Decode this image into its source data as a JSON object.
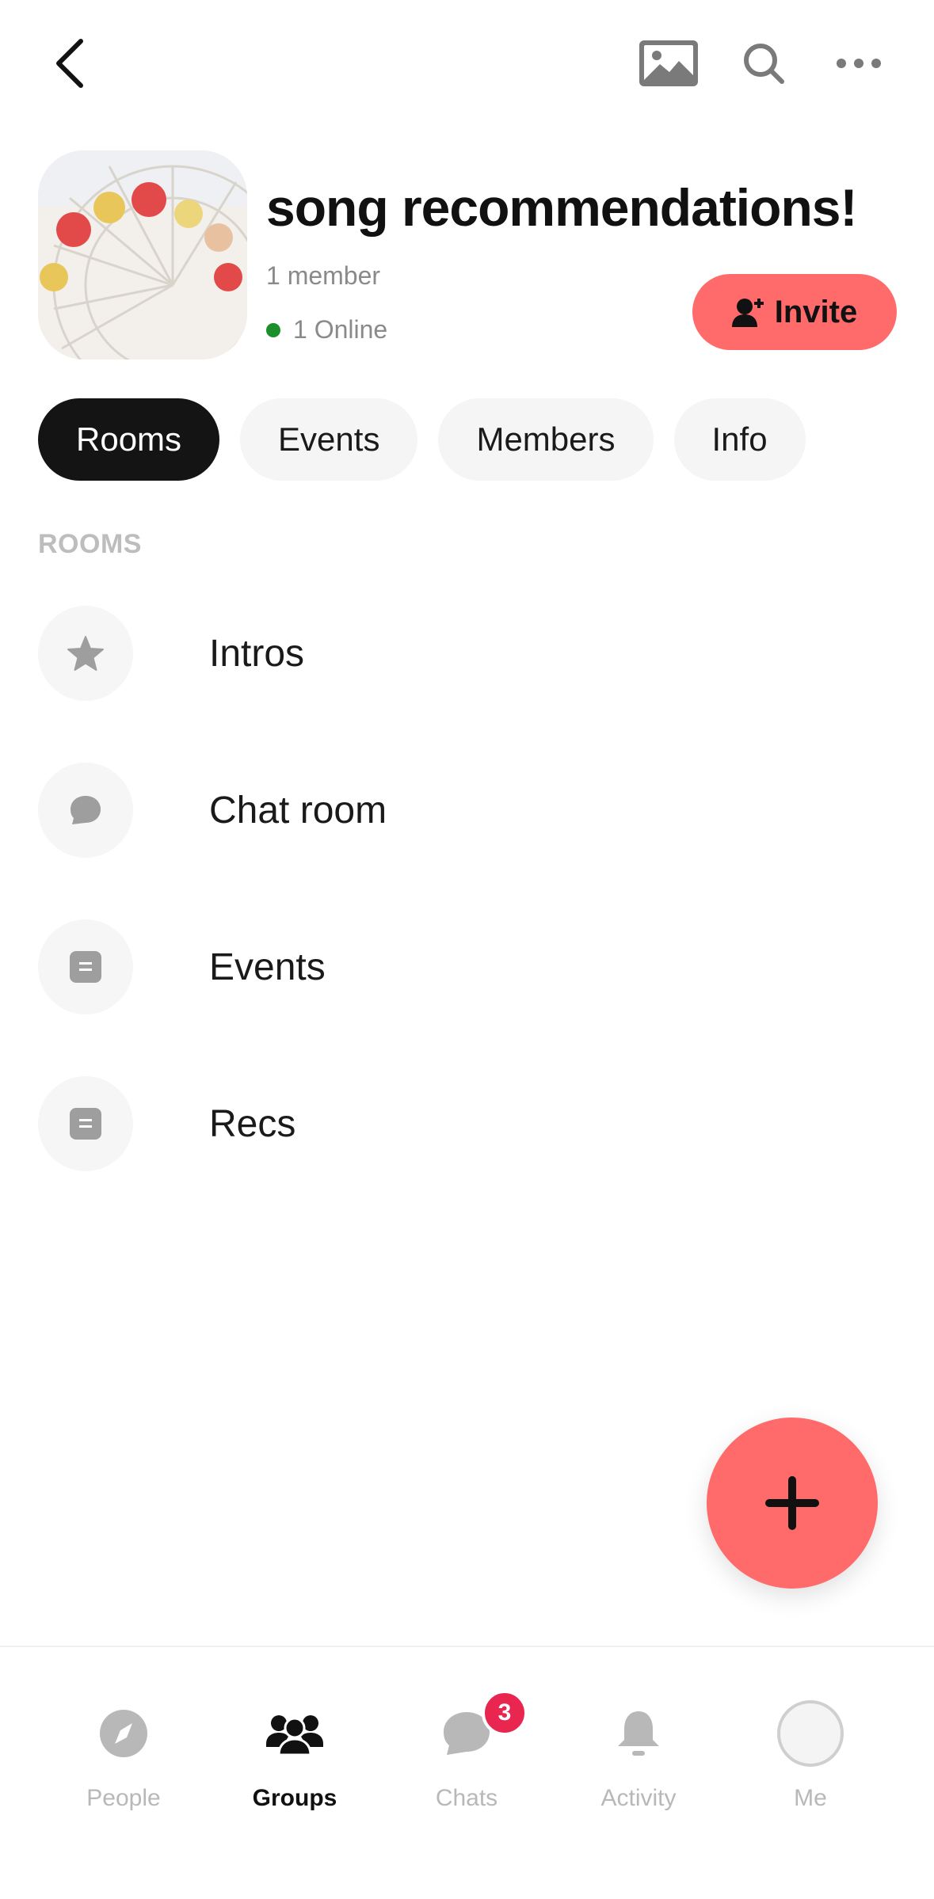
{
  "group": {
    "title": "song recommendations!",
    "member_count": "1 member",
    "online": "1 Online",
    "invite_label": "Invite"
  },
  "tabs": [
    {
      "label": "Rooms",
      "active": true
    },
    {
      "label": "Events",
      "active": false
    },
    {
      "label": "Members",
      "active": false
    },
    {
      "label": "Info",
      "active": false
    }
  ],
  "rooms_section": {
    "label": "ROOMS",
    "items": [
      {
        "label": "Intros",
        "icon": "star-icon"
      },
      {
        "label": "Chat room",
        "icon": "chat-bubble-icon"
      },
      {
        "label": "Events",
        "icon": "note-icon"
      },
      {
        "label": "Recs",
        "icon": "note-icon"
      }
    ]
  },
  "nav": {
    "items": [
      {
        "label": "People",
        "icon": "compass-icon",
        "active": false
      },
      {
        "label": "Groups",
        "icon": "groups-icon",
        "active": true
      },
      {
        "label": "Chats",
        "icon": "chat-icon",
        "active": false,
        "badge": "3"
      },
      {
        "label": "Activity",
        "icon": "bell-icon",
        "active": false
      },
      {
        "label": "Me",
        "icon": "profile-avatar",
        "active": false
      }
    ]
  },
  "colors": {
    "accent": "#ff6b6b",
    "active_tab": "#141414",
    "online": "#1a8f2a",
    "badge": "#e8264f"
  }
}
